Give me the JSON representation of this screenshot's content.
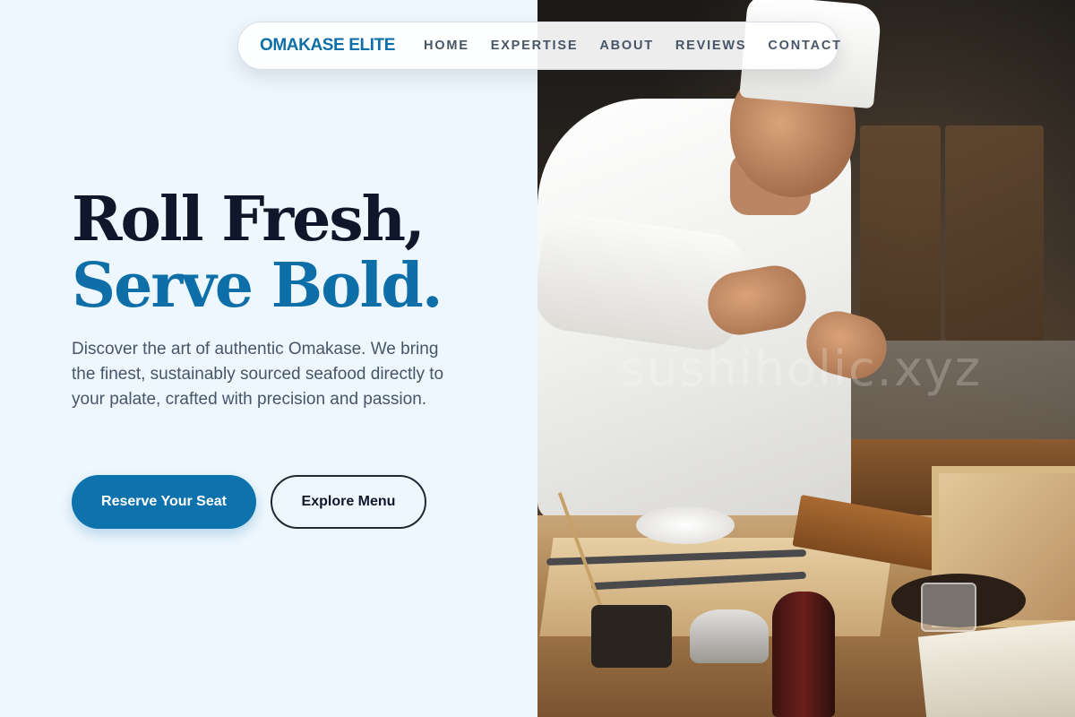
{
  "nav": {
    "brand": "OMAKASE ELITE",
    "links": [
      "HOME",
      "EXPERTISE",
      "ABOUT",
      "REVIEWS",
      "CONTACT"
    ]
  },
  "hero": {
    "headline_line1": "Roll Fresh,",
    "headline_line2": "Serve Bold.",
    "description": "Discover the art of authentic Omakase. We bring the finest, sustainably sourced seafood directly to your palate, crafted with precision and passion.",
    "primary_button": "Reserve Your Seat",
    "secondary_button": "Explore Menu"
  },
  "image": {
    "watermark": "sushiholic.xyz"
  },
  "colors": {
    "accent": "#0e72ad",
    "background": "#eff7fe",
    "heading_dark": "#0f172a",
    "body_text": "#475569"
  }
}
